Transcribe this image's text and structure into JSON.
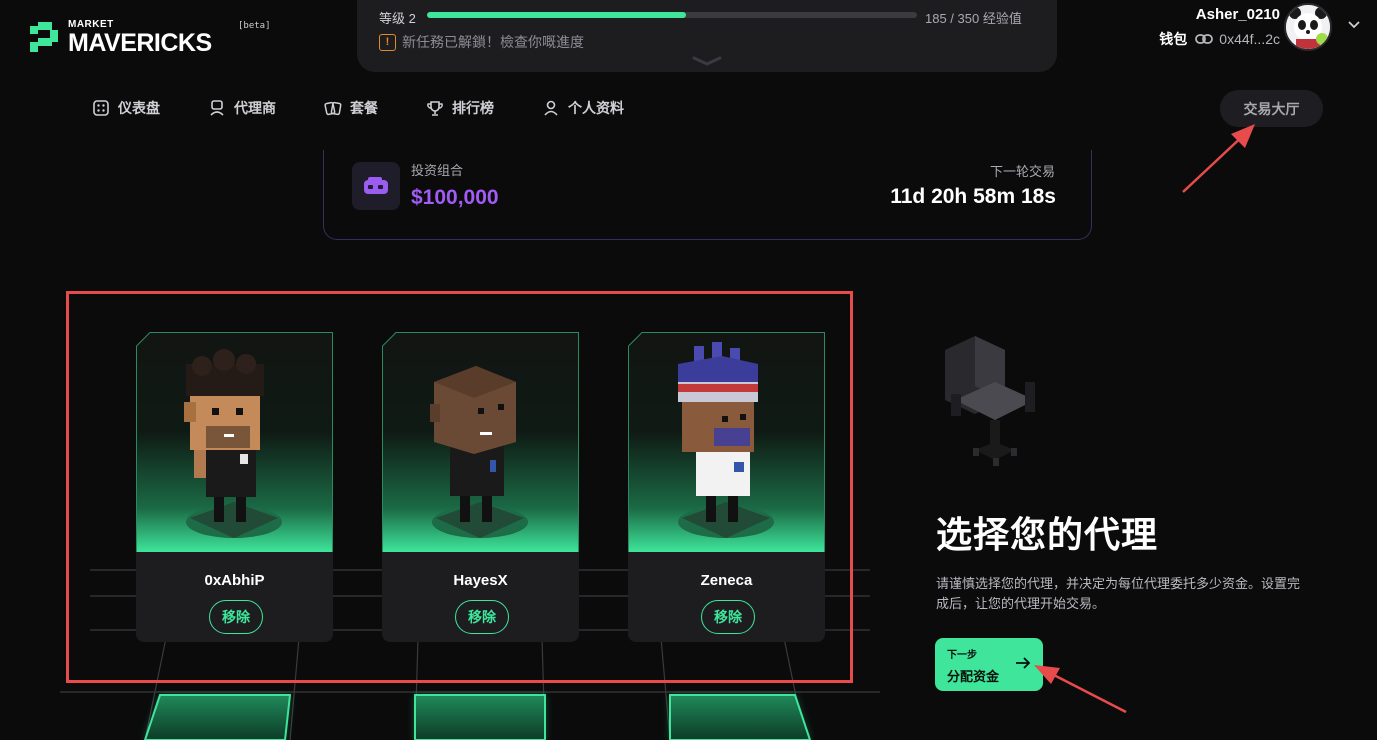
{
  "brand": {
    "small": "MARKET",
    "name": "MAVERICKS",
    "tag": "[beta]"
  },
  "xp": {
    "level": "等级 2",
    "value": "185 / 350 经验值",
    "current": 185,
    "max": 350,
    "notice": "新任務已解鎖！檢查你嘅進度"
  },
  "user": {
    "name": "Asher_0210",
    "wallet_label": "钱包",
    "wallet_address": "0x44f...2c"
  },
  "nav": [
    {
      "label": "仪表盘",
      "icon": "dashboard-icon"
    },
    {
      "label": "代理商",
      "icon": "agent-icon"
    },
    {
      "label": "套餐",
      "icon": "cards-icon"
    },
    {
      "label": "排行榜",
      "icon": "trophy-icon"
    },
    {
      "label": "个人资料",
      "icon": "user-icon"
    }
  ],
  "trade_hall": "交易大厅",
  "portfolio": {
    "label": "投资组合",
    "value": "$100,000",
    "next_label": "下一轮交易",
    "next_value": "11d 20h 58m 18s"
  },
  "agents": [
    {
      "name": "0xAbhiP",
      "remove": "移除"
    },
    {
      "name": "HayesX",
      "remove": "移除"
    },
    {
      "name": "Zeneca",
      "remove": "移除"
    }
  ],
  "selection": {
    "title": "选择您的代理",
    "description": "请谨慎选择您的代理，并决定为每位代理委托多少资金。设置完成后，让您的代理开始交易。",
    "next_small": "下一步",
    "next_label": "分配资金"
  },
  "colors": {
    "accent": "#3ee59a",
    "purple": "#a05cf4",
    "annotation": "#e84b4b"
  }
}
